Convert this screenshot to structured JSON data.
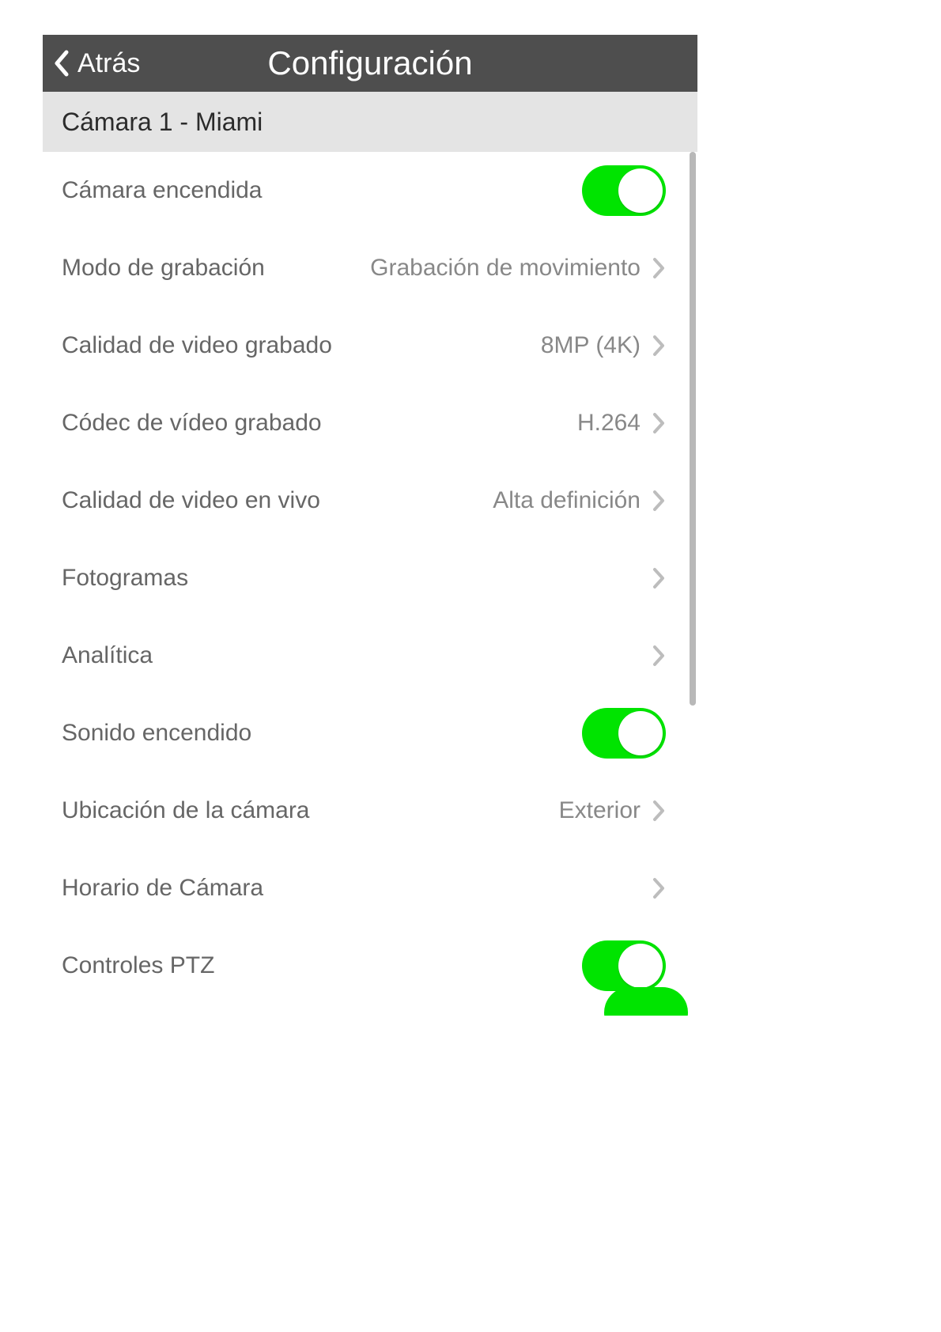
{
  "header": {
    "back_label": "Atrás",
    "title": "Configuración"
  },
  "section": {
    "title": "Cámara 1 - Miami"
  },
  "rows": {
    "camera_on": {
      "label": "Cámara encendida",
      "toggle": true
    },
    "rec_mode": {
      "label": "Modo de grabación",
      "value": "Grabación de movimiento"
    },
    "rec_quality": {
      "label": "Calidad de video grabado",
      "value": "8MP (4K)"
    },
    "rec_codec": {
      "label": "Códec de vídeo grabado",
      "value": "H.264"
    },
    "live_quality": {
      "label": "Calidad de video en vivo",
      "value": "Alta definición"
    },
    "frames": {
      "label": "Fotogramas",
      "value": ""
    },
    "analytics": {
      "label": "Analítica",
      "value": ""
    },
    "sound_on": {
      "label": "Sonido encendido",
      "toggle": true
    },
    "location": {
      "label": "Ubicación de la cámara",
      "value": "Exterior"
    },
    "schedule": {
      "label": "Horario de Cámara",
      "value": ""
    },
    "ptz": {
      "label": "Controles PTZ",
      "toggle": true
    }
  }
}
